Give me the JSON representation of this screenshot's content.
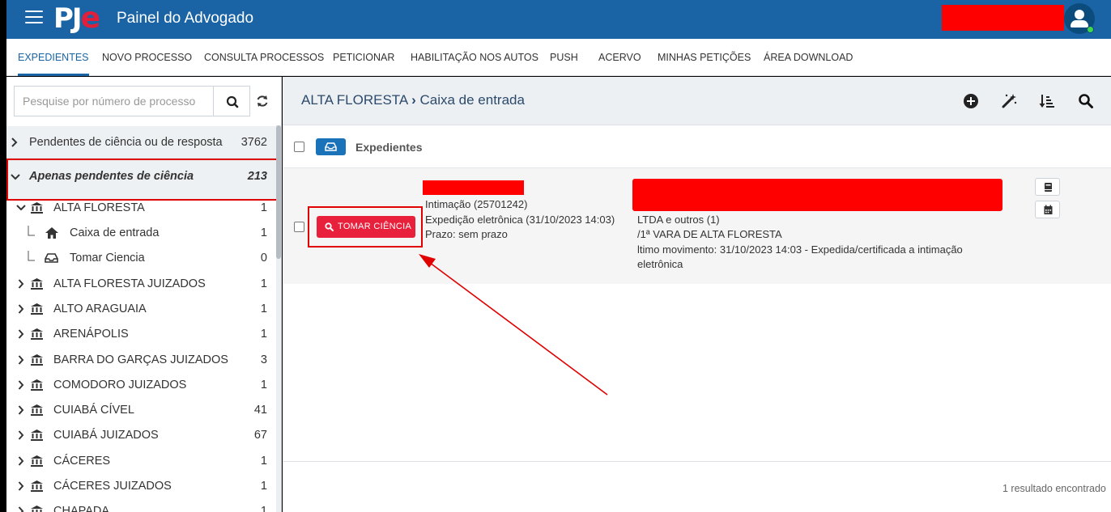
{
  "header": {
    "logo_pj": "PJ",
    "logo_e": "e",
    "title": "Painel do Advogado"
  },
  "nav": {
    "tabs": [
      {
        "label": "EXPEDIENTES",
        "active": true
      },
      {
        "label": "NOVO PROCESSO"
      },
      {
        "label": "CONSULTA PROCESSOS"
      },
      {
        "label": "PETICIONAR"
      },
      {
        "label": "HABILITAÇÃO NOS AUTOS"
      },
      {
        "label": "PUSH"
      },
      {
        "label": "ACERVO"
      },
      {
        "label": "MINHAS PETIÇÕES"
      },
      {
        "label": "ÁREA DOWNLOAD"
      }
    ]
  },
  "sidebar": {
    "search_placeholder": "Pesquise por número de processo",
    "categories": [
      {
        "label": "Pendentes de ciência ou de resposta",
        "count": "3762"
      },
      {
        "label": "Apenas pendentes de ciência",
        "count": "213"
      }
    ],
    "tree": [
      {
        "label": "ALTA FLORESTA",
        "count": "1",
        "expanded": true
      },
      {
        "label": "Caixa de entrada",
        "count": "1",
        "child": true,
        "icon": "home-icon"
      },
      {
        "label": "Tomar Ciencia",
        "count": "0",
        "child": true,
        "icon": "inbox-icon"
      },
      {
        "label": "ALTA FLORESTA JUIZADOS",
        "count": "1"
      },
      {
        "label": "ALTO ARAGUAIA",
        "count": "1"
      },
      {
        "label": "ARENÁPOLIS",
        "count": "1"
      },
      {
        "label": "BARRA DO GARÇAS JUIZADOS",
        "count": "3"
      },
      {
        "label": "COMODORO JUIZADOS",
        "count": "1"
      },
      {
        "label": "CUIABÁ CÍVEL",
        "count": "41"
      },
      {
        "label": "CUIABÁ JUIZADOS",
        "count": "67"
      },
      {
        "label": "CÁCERES",
        "count": "1"
      },
      {
        "label": "CÁCERES JUIZADOS",
        "count": "1"
      },
      {
        "label": "CHAPADA",
        "count": "1"
      }
    ]
  },
  "main": {
    "breadcrumb_root": "ALTA FLORESTA",
    "breadcrumb_sep": "›",
    "breadcrumb_leaf": "Caixa de entrada",
    "list_title": "Expedientes",
    "item": {
      "button_label": "TOMAR CIÊNCIA",
      "type": "Intimação (25701242)",
      "expedicao": "Expedição eletrônica (31/10/2023 14:03)",
      "prazo": "Prazo: sem prazo",
      "parties": "LTDA e outros (1)",
      "vara": "/1ª VARA DE ALTA FLORESTA",
      "movimento": "ltimo movimento: 31/10/2023 14:03 - Expedida/certificada a intimação",
      "movimento2": "eletrônica"
    },
    "results": "1 resultado encontrado"
  },
  "colors": {
    "brand": "#1a64a6",
    "danger": "#e8203c",
    "redaction": "#ff0000"
  }
}
